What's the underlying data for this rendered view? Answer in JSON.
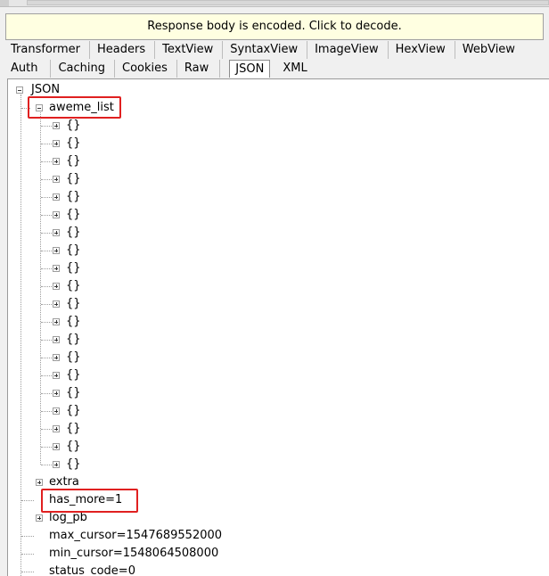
{
  "banner": {
    "text": "Response body is encoded. Click to decode."
  },
  "tabs_row1": [
    "Transformer",
    "Headers",
    "TextView",
    "SyntaxView",
    "ImageView",
    "HexView",
    "WebView"
  ],
  "tabs_row2": [
    "Auth",
    "Caching",
    "Cookies",
    "Raw",
    "JSON",
    "XML"
  ],
  "active_tab": "JSON",
  "tree": {
    "root": "JSON",
    "aweme_list": {
      "label": "aweme_list",
      "children": [
        "{}",
        "{}",
        "{}",
        "{}",
        "{}",
        "{}",
        "{}",
        "{}",
        "{}",
        "{}",
        "{}",
        "{}",
        "{}",
        "{}",
        "{}",
        "{}",
        "{}",
        "{}",
        "{}",
        "{}"
      ]
    },
    "extra": "extra",
    "has_more": "has_more=1",
    "log_pb": "log_pb",
    "max_cursor": "max_cursor=1547689552000",
    "min_cursor": "min_cursor=1548064508000",
    "status_code": "status_code=0"
  },
  "colors": {
    "highlight": "#e02020",
    "banner_bg": "#ffffe1"
  }
}
